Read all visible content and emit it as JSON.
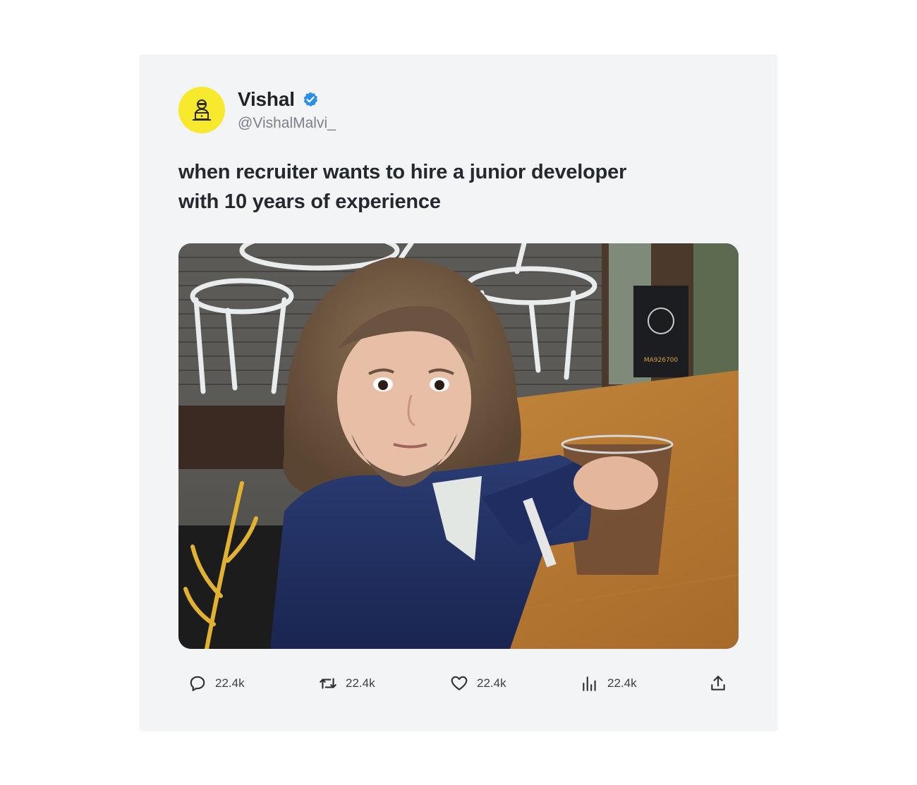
{
  "post": {
    "author_name": "Vishal",
    "author_handle": "@VishalMalvi_",
    "avatar_icon": "developer-at-laptop-icon",
    "verified_icon": "verified-badge-icon",
    "verified_color": "#2b8ee8",
    "avatar_color": "#f7e92c",
    "text_line1": "when recruiter wants to hire a junior developer",
    "text_line2": "with 10 years of experience",
    "image": {
      "description_icon": "photo-bearded-person-at-cafe-table",
      "sign_text": "MA926700"
    }
  },
  "actions": {
    "reply": {
      "icon": "comment-icon",
      "count": "22.4k"
    },
    "retweet": {
      "icon": "retweet-icon",
      "count": "22.4k"
    },
    "like": {
      "icon": "heart-icon",
      "count": "22.4k"
    },
    "views": {
      "icon": "views-chart-icon",
      "count": "22.4k"
    },
    "share": {
      "icon": "share-upload-icon"
    }
  }
}
